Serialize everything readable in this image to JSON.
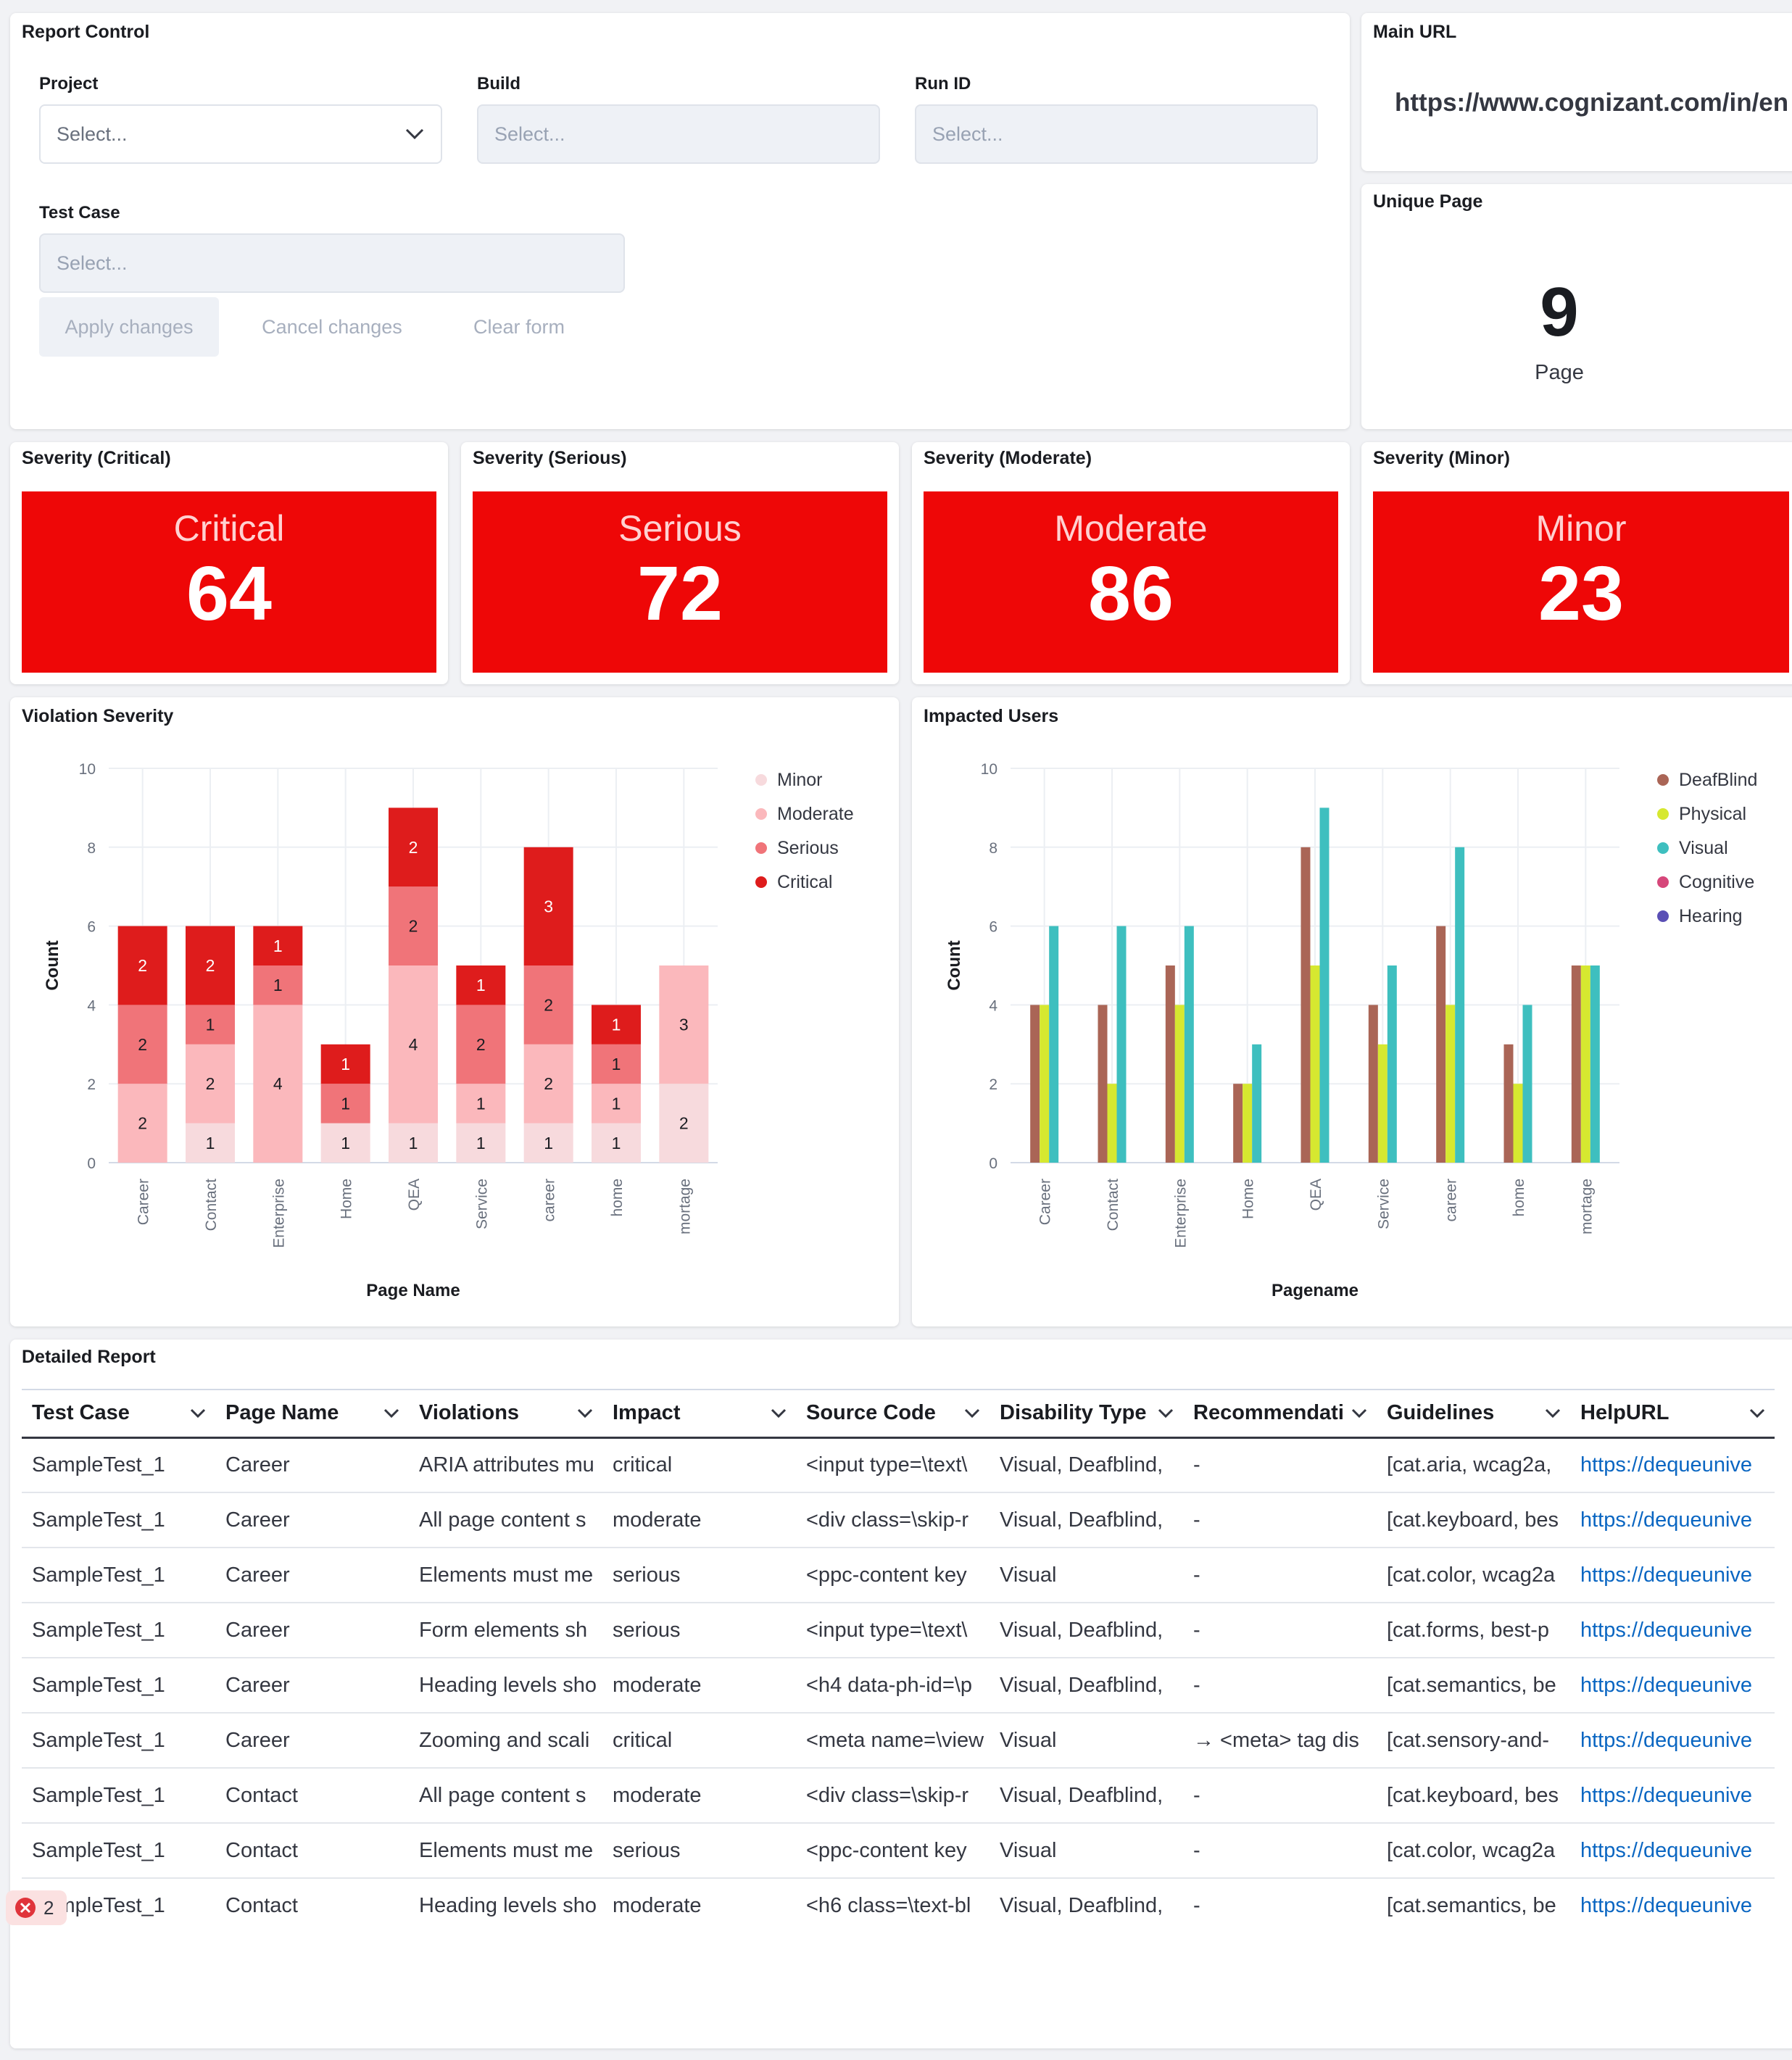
{
  "report_control": {
    "title": "Report Control",
    "project": {
      "label": "Project",
      "placeholder": "Select..."
    },
    "build": {
      "label": "Build",
      "placeholder": "Select..."
    },
    "run_id": {
      "label": "Run ID",
      "placeholder": "Select..."
    },
    "test_case": {
      "label": "Test Case",
      "placeholder": "Select..."
    },
    "apply_label": "Apply changes",
    "cancel_label": "Cancel changes",
    "clear_label": "Clear form"
  },
  "main_url": {
    "title": "Main URL",
    "value": "https://www.cognizant.com/in/en"
  },
  "unique_page": {
    "title": "Unique Page",
    "value": "9",
    "unit": "Page"
  },
  "severity_cards": [
    {
      "title": "Severity (Critical)",
      "label": "Critical",
      "value": "64"
    },
    {
      "title": "Severity (Serious)",
      "label": "Serious",
      "value": "72"
    },
    {
      "title": "Severity (Moderate)",
      "label": "Moderate",
      "value": "86"
    },
    {
      "title": "Severity (Minor)",
      "label": "Minor",
      "value": "23"
    }
  ],
  "violation_panel": {
    "title": "Violation Severity"
  },
  "impacted_panel": {
    "title": "Impacted Users"
  },
  "chart_data": [
    {
      "type": "bar",
      "stacked": true,
      "title": "Violation Severity",
      "xlabel": "Page Name",
      "ylabel": "Count",
      "ylim": [
        0,
        10
      ],
      "yticks": [
        0,
        2,
        4,
        6,
        8,
        10
      ],
      "legend_position": "top-right",
      "grid": true,
      "categories": [
        "Career",
        "Contact",
        "Enterprise",
        "Home",
        "QEA",
        "Service",
        "career",
        "home",
        "mortage"
      ],
      "series": [
        {
          "name": "Minor",
          "color": "#f7dadd",
          "values": [
            0,
            1,
            0,
            1,
            1,
            1,
            1,
            1,
            2
          ]
        },
        {
          "name": "Moderate",
          "color": "#fbb8bc",
          "values": [
            2,
            2,
            4,
            0,
            4,
            1,
            2,
            1,
            3
          ]
        },
        {
          "name": "Serious",
          "color": "#f07479",
          "values": [
            2,
            1,
            1,
            1,
            2,
            2,
            2,
            1,
            0
          ]
        },
        {
          "name": "Critical",
          "color": "#de1c1c",
          "values": [
            2,
            2,
            1,
            1,
            2,
            1,
            3,
            1,
            0
          ]
        }
      ]
    },
    {
      "type": "bar",
      "stacked": false,
      "title": "Impacted Users",
      "xlabel": "Pagename",
      "ylabel": "Count",
      "ylim": [
        0,
        10
      ],
      "yticks": [
        0,
        2,
        4,
        6,
        8,
        10
      ],
      "legend_position": "top-right",
      "grid": true,
      "categories": [
        "Career",
        "Contact",
        "Enterprise",
        "Home",
        "QEA",
        "Service",
        "career",
        "home",
        "mortage"
      ],
      "series": [
        {
          "name": "DeafBlind",
          "color": "#aa6556",
          "values": [
            4,
            4,
            5,
            2,
            8,
            4,
            6,
            3,
            5
          ]
        },
        {
          "name": "Physical",
          "color": "#d6e830",
          "values": [
            4,
            2,
            4,
            2,
            5,
            3,
            4,
            2,
            5
          ]
        },
        {
          "name": "Visual",
          "color": "#3ebfbf",
          "values": [
            6,
            6,
            6,
            3,
            9,
            5,
            8,
            4,
            5
          ]
        },
        {
          "name": "Cognitive",
          "color": "#d6477a",
          "values": [
            0,
            0,
            0,
            0,
            0,
            0,
            0,
            0,
            0
          ]
        },
        {
          "name": "Hearing",
          "color": "#5a4fb5",
          "values": [
            0,
            0,
            0,
            0,
            0,
            0,
            0,
            0,
            0
          ]
        }
      ]
    }
  ],
  "detailed_report": {
    "title": "Detailed Report",
    "columns": [
      "Test Case",
      "Page Name",
      "Violations",
      "Impact",
      "Source Code",
      "Disability Type",
      "Recommendati",
      "Guidelines",
      "HelpURL"
    ],
    "rows": [
      [
        "SampleTest_1",
        "Career",
        "ARIA attributes mu",
        "critical",
        "<input type=\\text\\",
        "Visual, Deafblind,",
        "-",
        "[cat.aria, wcag2a,",
        "https://dequeunive"
      ],
      [
        "SampleTest_1",
        "Career",
        "All page content s",
        "moderate",
        "<div class=\\skip-r",
        "Visual, Deafblind,",
        "-",
        "[cat.keyboard, bes",
        "https://dequeunive"
      ],
      [
        "SampleTest_1",
        "Career",
        "Elements must me",
        "serious",
        "<ppc-content key",
        "Visual",
        "-",
        "[cat.color, wcag2a",
        "https://dequeunive"
      ],
      [
        "SampleTest_1",
        "Career",
        "Form elements sh",
        "serious",
        "<input type=\\text\\",
        "Visual, Deafblind,",
        "-",
        "[cat.forms, best-p",
        "https://dequeunive"
      ],
      [
        "SampleTest_1",
        "Career",
        "Heading levels sho",
        "moderate",
        "<h4 data-ph-id=\\p",
        "Visual, Deafblind,",
        "-",
        "[cat.semantics, be",
        "https://dequeunive"
      ],
      [
        "SampleTest_1",
        "Career",
        "Zooming and scali",
        "critical",
        "<meta name=\\view",
        "Visual",
        "→ <meta> tag dis",
        "[cat.sensory-and-",
        "https://dequeunive"
      ],
      [
        "SampleTest_1",
        "Contact",
        "All page content s",
        "moderate",
        "<div class=\\skip-r",
        "Visual, Deafblind,",
        "-",
        "[cat.keyboard, bes",
        "https://dequeunive"
      ],
      [
        "SampleTest_1",
        "Contact",
        "Elements must me",
        "serious",
        "<ppc-content key",
        "Visual",
        "-",
        "[cat.color, wcag2a",
        "https://dequeunive"
      ],
      [
        "SampleTest_1",
        "Contact",
        "Heading levels sho",
        "moderate",
        "<h6 class=\\text-bl",
        "Visual, Deafblind,",
        "-",
        "[cat.semantics, be",
        "https://dequeunive"
      ]
    ]
  },
  "error_badge": {
    "count": "2",
    "color": "#e0343b"
  }
}
